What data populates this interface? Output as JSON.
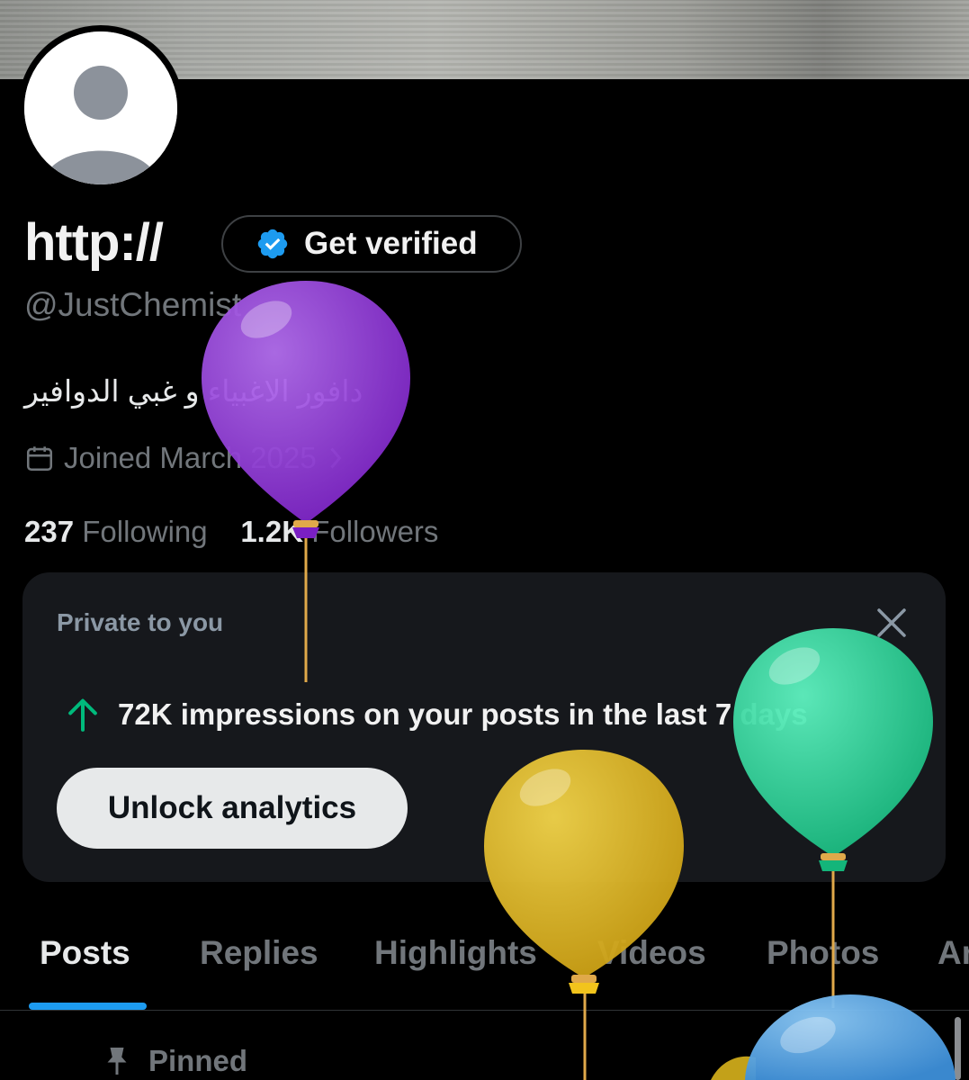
{
  "profile": {
    "display_name": "http://",
    "handle": "@JustChemist",
    "bio": "دافور الاغبياء و غبي الدوافير",
    "joined": "Joined March 2025",
    "following_count": "237",
    "following_label": "Following",
    "followers_count": "1.2K",
    "followers_label": "Followers"
  },
  "verify_button": {
    "label": "Get verified"
  },
  "insight_card": {
    "private_label": "Private to you",
    "message": "72K impressions on your posts in the last 7 days",
    "unlock_label": "Unlock analytics"
  },
  "tabs": [
    {
      "label": "Posts",
      "active": true
    },
    {
      "label": "Replies"
    },
    {
      "label": "Highlights"
    },
    {
      "label": "Videos"
    },
    {
      "label": "Photos"
    },
    {
      "label": "Ar"
    }
  ],
  "pinned_label": "Pinned",
  "colors": {
    "accent": "#1d9bf0",
    "background": "#000000",
    "card": "#16181c",
    "up_arrow": "#00ba7c",
    "balloon_purple": "#8b2bd3",
    "balloon_green": "#1fc98e",
    "balloon_yellow": "#d8b21c",
    "balloon_blue": "#4aa3e8"
  },
  "icons": [
    "verified-badge-icon",
    "calendar-icon",
    "chevron-right-icon",
    "close-icon",
    "arrow-up-icon",
    "pin-icon",
    "default-avatar-icon"
  ]
}
